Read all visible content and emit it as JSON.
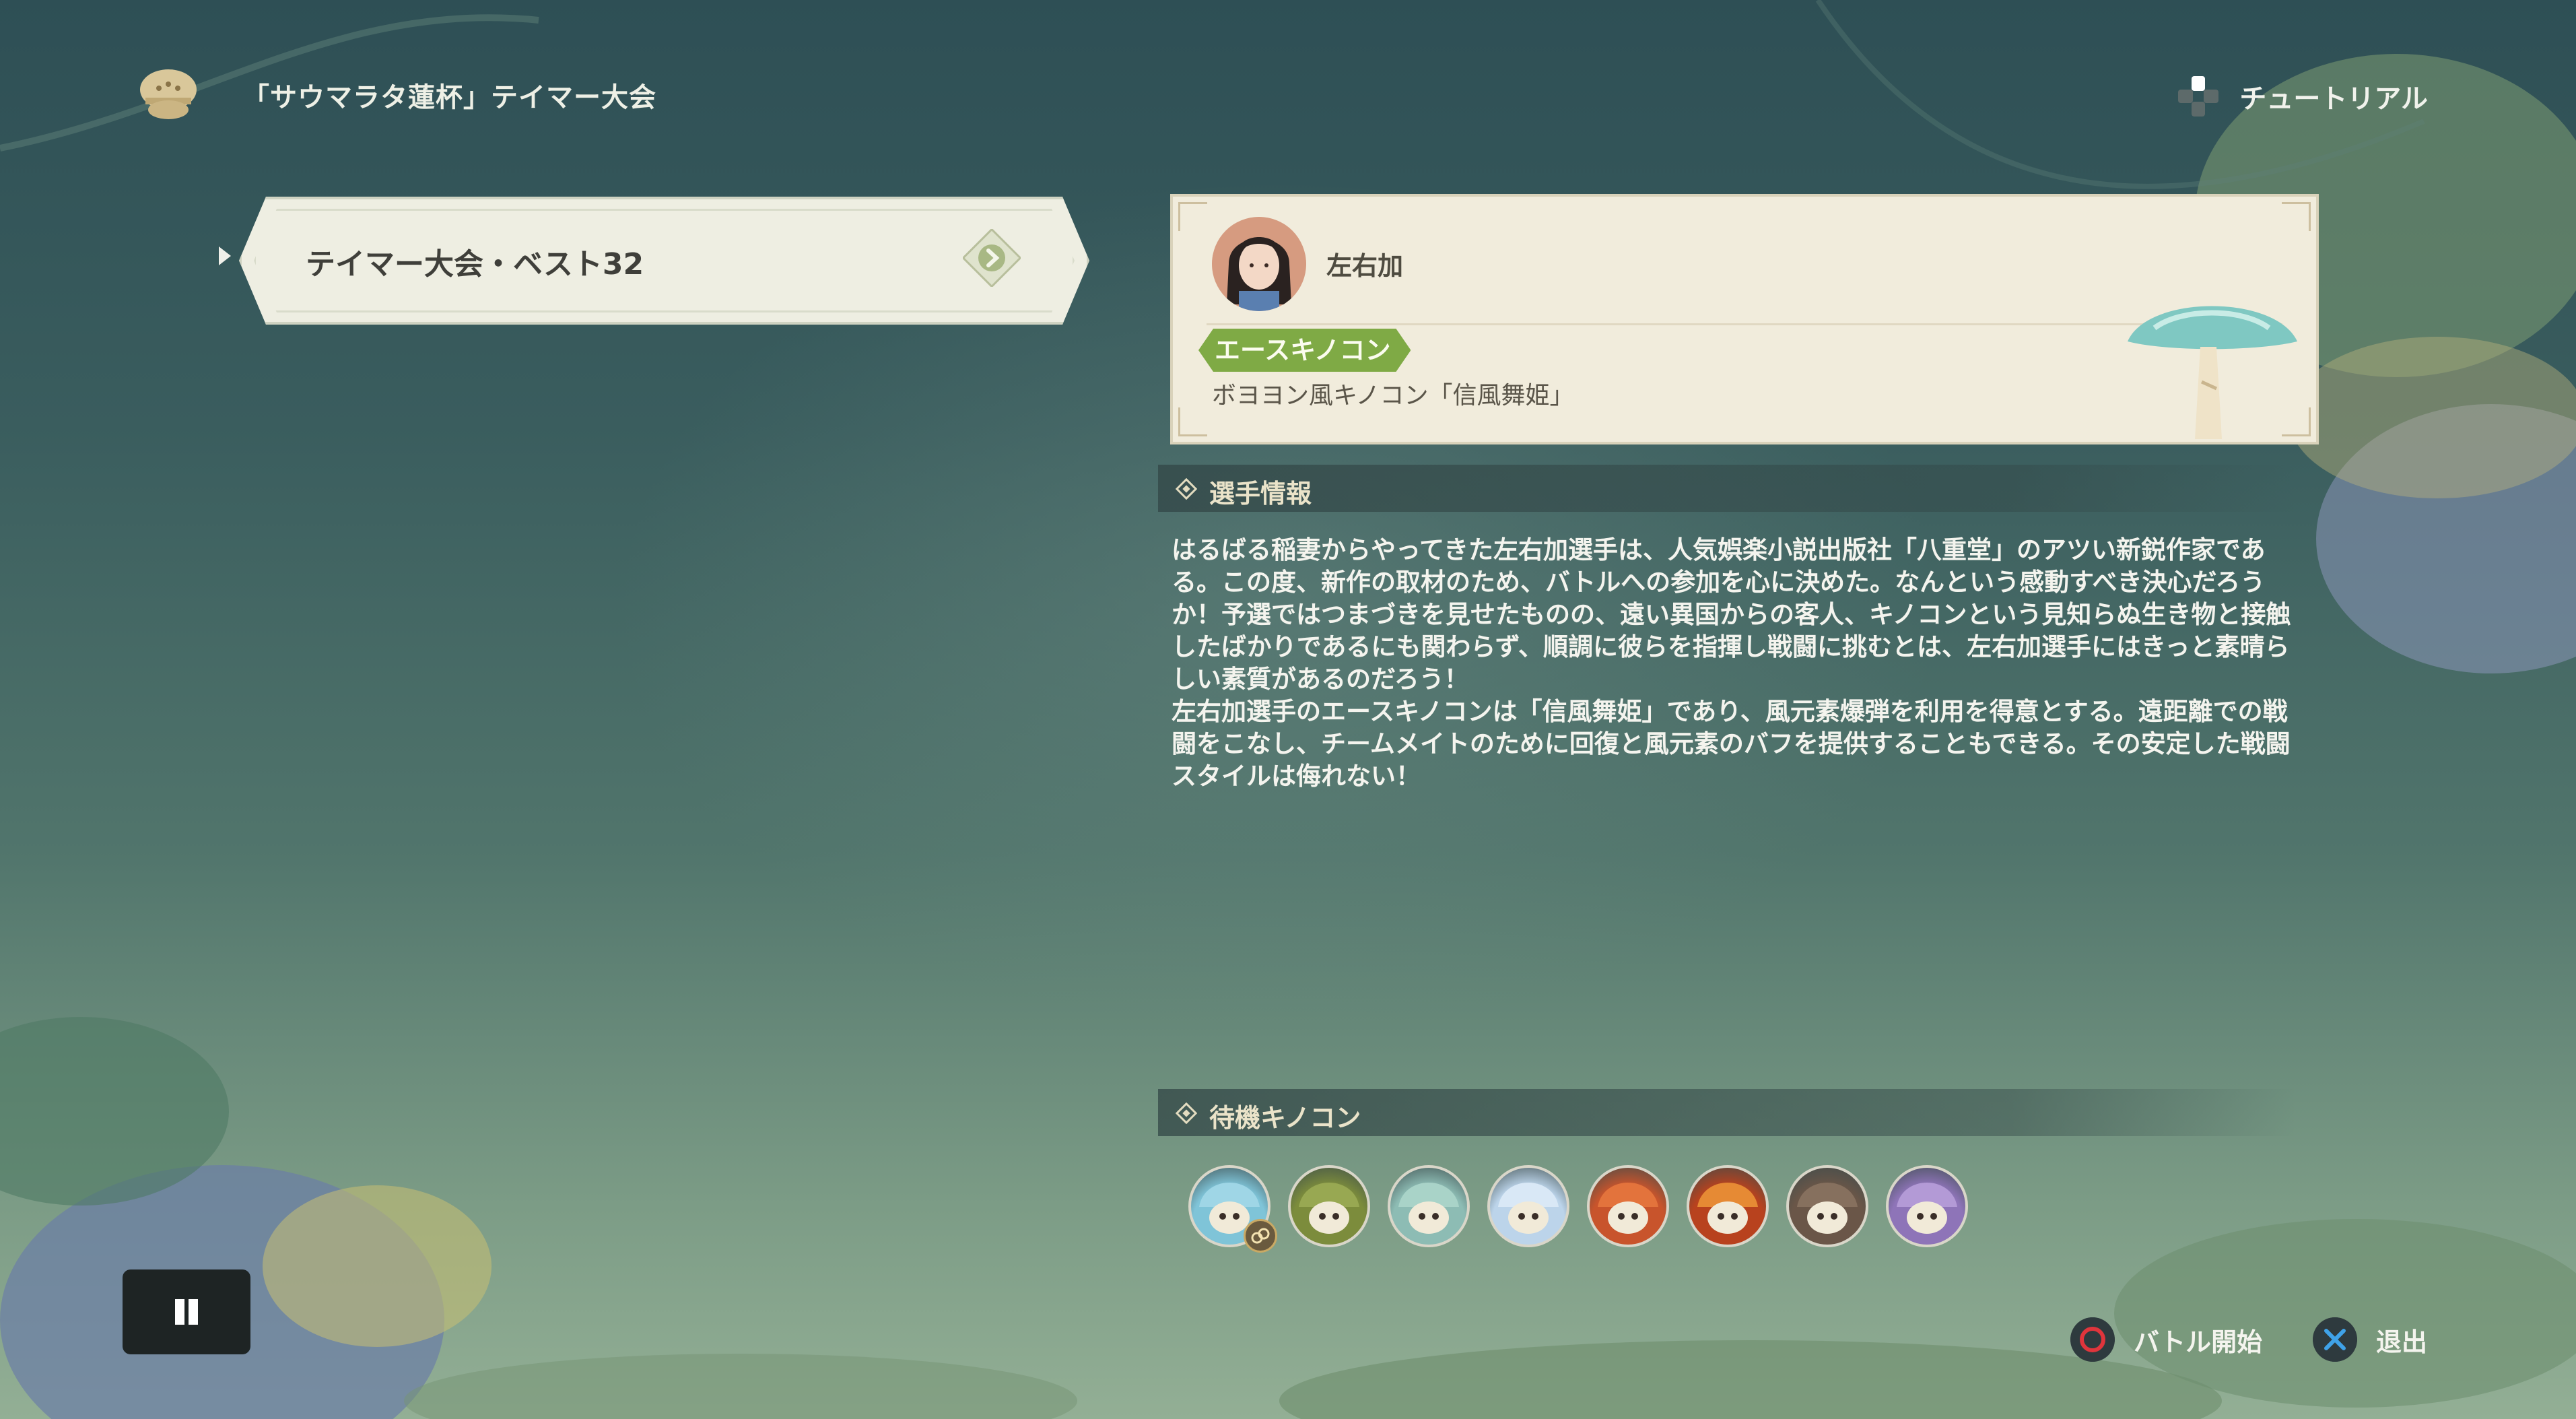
{
  "header": {
    "event_title": "「サウマラタ蓮杯」テイマー大会",
    "tutorial_label": "チュートリアル"
  },
  "stage": {
    "label": "テイマー大会・ベスト32"
  },
  "player": {
    "name": "左右加",
    "ace_badge": "エースキノコン",
    "ace_name": "ボヨヨン風キノコン「信風舞姫」"
  },
  "player_info": {
    "section_title": "選手情報",
    "paragraphs": [
      "はるばる稲妻からやってきた左右加選手は、人気娯楽小説出版社「八重堂」のアツい新鋭作家である。この度、新作の取材のため、バトルへの参加を心に決めた。なんという感動すべき決心だろうか！予選ではつまづきを見せたものの、遠い異国からの客人、キノコンという見知らぬ生き物と接触したばかりであるにも関わらず、順調に彼らを指揮し戦闘に挑むとは、左右加選手にはきっと素晴らしい素質があるのだろう！",
      "左右加選手のエースキノコンは「信風舞姫」であり、風元素爆弾を利用を得意とする。遠距離での戦闘をこなし、チームメイトのために回復と風元素のバフを提供することもできる。その安定した戦闘スタイルは侮れない！"
    ]
  },
  "standby": {
    "section_title": "待機キノコン",
    "minions": [
      {
        "icon": "blue-fluffy-fungi-icon",
        "color": "#7fc4d8",
        "cap": "#9fd6e6"
      },
      {
        "icon": "green-leaf-fungi-icon",
        "color": "#7c8c3c",
        "cap": "#98a852"
      },
      {
        "icon": "teal-cap-fungi-icon",
        "color": "#8dbcb4",
        "cap": "#a9d3c8"
      },
      {
        "icon": "ice-crystal-fungi-icon",
        "color": "#bcd4ea",
        "cap": "#d9e8f6"
      },
      {
        "icon": "orange-fire-fungi-icon",
        "color": "#c8542c",
        "cap": "#e3733c"
      },
      {
        "icon": "flame-crown-fungi-icon",
        "color": "#b8421e",
        "cap": "#e68a34"
      },
      {
        "icon": "brown-stone-fungi-icon",
        "color": "#6a5648",
        "cap": "#86705e"
      },
      {
        "icon": "purple-cap-fungi-icon",
        "color": "#8e74b8",
        "cap": "#b39ad6"
      }
    ]
  },
  "prompts": {
    "start_battle_label": "バトル開始",
    "exit_label": "退出"
  },
  "colors": {
    "ace_badge": "#7faa45",
    "card_bg": "#f1ecdc",
    "circle_button": "#e0353c",
    "cross_button": "#3fa2e8"
  }
}
